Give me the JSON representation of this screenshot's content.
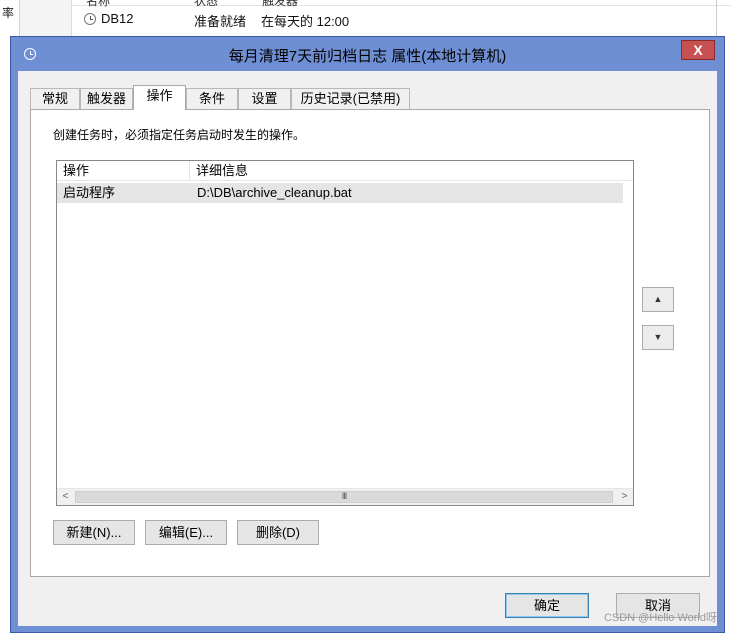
{
  "background": {
    "left_fragment": "率",
    "header_cols": [
      "名称",
      "状态",
      "触发器"
    ],
    "task_row": {
      "name": "DB12",
      "status": "准备就绪",
      "trigger": "在每天的 12:00"
    }
  },
  "dialog": {
    "title": "每月清理7天前归档日志 属性(本地计算机)",
    "close_glyph": "X",
    "tabs": [
      {
        "label": "常规"
      },
      {
        "label": "触发器"
      },
      {
        "label": "操作"
      },
      {
        "label": "条件"
      },
      {
        "label": "设置"
      },
      {
        "label": "历史记录(已禁用)"
      }
    ],
    "active_tab": "操作",
    "instruction": "创建任务时，必须指定任务启动时发生的操作。",
    "actions_table": {
      "columns": [
        "操作",
        "详细信息"
      ],
      "rows": [
        {
          "action": "启动程序",
          "details": "D:\\DB\\archive_cleanup.bat"
        }
      ]
    },
    "move_up_glyph": "▲",
    "move_down_glyph": "▼",
    "scroll_left_glyph": "<",
    "scroll_right_glyph": ">",
    "scroll_thumb_glyph": "III",
    "buttons": {
      "new": "新建(N)...",
      "edit": "编辑(E)...",
      "delete": "删除(D)",
      "ok": "确定",
      "cancel": "取消"
    }
  },
  "watermark": "CSDN @Hello World呀"
}
